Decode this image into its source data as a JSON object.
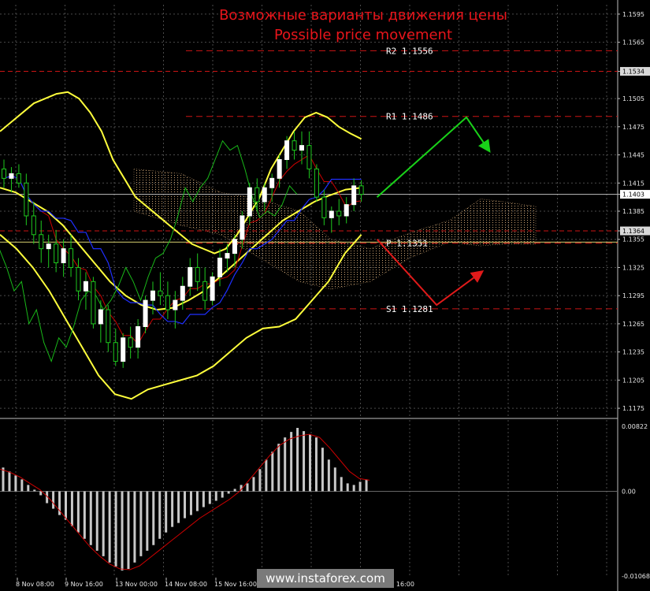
{
  "header": {
    "title_ru": "Возможные варианты движения цены",
    "title_en": "Possible price movement"
  },
  "watermark": "www.instaforex.com",
  "colors": {
    "background": "#000000",
    "bull_candle": "#ffffff",
    "bear_candle": "#9a9a9a",
    "bollinger": "#ffff3c",
    "ichimoku_tenkan": "#cc0000",
    "ichimoku_kijun": "#1f2fff",
    "ichimoku_chikou": "#19b819",
    "cloud": "#c8a070",
    "pivot_lines": "#cc1414",
    "macd_hist": "#c8c8c8",
    "macd_signal": "#cc0000",
    "up_arrow": "#19d119",
    "down_arrow": "#e01a1a"
  },
  "chart_data": {
    "type": "candlestick",
    "symbol_price_axis": {
      "ylim": [
        1.1165,
        1.1605
      ],
      "ticks": [
        "1.1595",
        "1.1565",
        "1.1534",
        "1.1505",
        "1.1475",
        "1.1445",
        "1.1415",
        "1.1403",
        "1.1385",
        "1.1364",
        "1.1355",
        "1.1325",
        "1.1295",
        "1.1265",
        "1.1235",
        "1.1205",
        "1.1175"
      ],
      "highlight_ticks": [
        {
          "label": "1.1534",
          "style": "box-light"
        },
        {
          "label": "1.1403",
          "style": "box-white"
        },
        {
          "label": "1.1364",
          "style": "box-light"
        }
      ]
    },
    "x_tick_labels": [
      "8 Nov 08:00",
      "9 Nov 16:00",
      "13 Nov 00:00",
      "14 Nov 08:00",
      "15 Nov 16:00",
      "16 Nov 16:00"
    ],
    "pivot_levels": [
      {
        "name": "R2",
        "label": "R2  1.1556",
        "value": 1.1556
      },
      {
        "name": "R1",
        "label": "R1  1.1486",
        "value": 1.1486
      },
      {
        "name": "P",
        "label": "P  1.1351",
        "value": 1.1351
      },
      {
        "name": "S1",
        "label": "S1  1.1281",
        "value": 1.1281
      }
    ],
    "horizontal_lines": [
      1.1534,
      1.1403,
      1.1364
    ],
    "candles": [
      [
        1.143,
        1.144,
        1.141,
        1.142
      ],
      [
        1.142,
        1.1432,
        1.1405,
        1.1425
      ],
      [
        1.1425,
        1.1435,
        1.141,
        1.1415
      ],
      [
        1.1415,
        1.1425,
        1.137,
        1.138
      ],
      [
        1.138,
        1.1395,
        1.135,
        1.136
      ],
      [
        1.136,
        1.1375,
        1.133,
        1.1345
      ],
      [
        1.1345,
        1.136,
        1.1325,
        1.135
      ],
      [
        1.135,
        1.1365,
        1.132,
        1.133
      ],
      [
        1.133,
        1.1355,
        1.1315,
        1.1345
      ],
      [
        1.1345,
        1.136,
        1.1315,
        1.1325
      ],
      [
        1.1325,
        1.1335,
        1.129,
        1.13
      ],
      [
        1.13,
        1.132,
        1.128,
        1.131
      ],
      [
        1.131,
        1.1315,
        1.126,
        1.1265
      ],
      [
        1.1265,
        1.129,
        1.1245,
        1.128
      ],
      [
        1.128,
        1.1285,
        1.1235,
        1.1245
      ],
      [
        1.1245,
        1.126,
        1.122,
        1.1225
      ],
      [
        1.1225,
        1.1255,
        1.1218,
        1.125
      ],
      [
        1.125,
        1.1262,
        1.1228,
        1.124
      ],
      [
        1.124,
        1.127,
        1.1228,
        1.1262
      ],
      [
        1.1262,
        1.1295,
        1.1255,
        1.129
      ],
      [
        1.129,
        1.131,
        1.1275,
        1.13
      ],
      [
        1.13,
        1.132,
        1.1285,
        1.1295
      ],
      [
        1.1295,
        1.131,
        1.127,
        1.128
      ],
      [
        1.128,
        1.13,
        1.126,
        1.129
      ],
      [
        1.129,
        1.1315,
        1.128,
        1.1305
      ],
      [
        1.1305,
        1.1335,
        1.1295,
        1.1325
      ],
      [
        1.1325,
        1.134,
        1.13,
        1.131
      ],
      [
        1.131,
        1.1325,
        1.128,
        1.129
      ],
      [
        1.129,
        1.132,
        1.1285,
        1.1315
      ],
      [
        1.1315,
        1.1345,
        1.1305,
        1.1335
      ],
      [
        1.1335,
        1.135,
        1.132,
        1.134
      ],
      [
        1.134,
        1.136,
        1.1325,
        1.1355
      ],
      [
        1.1355,
        1.1385,
        1.1345,
        1.138
      ],
      [
        1.138,
        1.1415,
        1.137,
        1.141
      ],
      [
        1.141,
        1.142,
        1.1385,
        1.1395
      ],
      [
        1.1395,
        1.1415,
        1.1385,
        1.141
      ],
      [
        1.141,
        1.1425,
        1.1395,
        1.142
      ],
      [
        1.142,
        1.1445,
        1.141,
        1.144
      ],
      [
        1.144,
        1.1465,
        1.143,
        1.146
      ],
      [
        1.146,
        1.147,
        1.144,
        1.145
      ],
      [
        1.145,
        1.147,
        1.1435,
        1.1455
      ],
      [
        1.1455,
        1.147,
        1.142,
        1.143
      ],
      [
        1.143,
        1.1435,
        1.1395,
        1.14
      ],
      [
        1.14,
        1.1408,
        1.137,
        1.1378
      ],
      [
        1.1378,
        1.139,
        1.1362,
        1.1385
      ],
      [
        1.1385,
        1.1398,
        1.137,
        1.138
      ],
      [
        1.138,
        1.14,
        1.1372,
        1.1392
      ],
      [
        1.1392,
        1.142,
        1.1385,
        1.1412
      ],
      [
        1.1412,
        1.1418,
        1.1395,
        1.1403
      ]
    ],
    "bollinger_upper": [
      1.147,
      1.148,
      1.149,
      1.15,
      1.1505,
      1.151,
      1.1512,
      1.1505,
      1.149,
      1.147,
      1.144,
      1.142,
      1.14,
      1.139,
      1.138,
      1.137,
      1.136,
      1.135,
      1.1345,
      1.134,
      1.1345,
      1.136,
      1.138,
      1.14,
      1.143,
      1.145,
      1.147,
      1.1485,
      1.149,
      1.1485,
      1.1475,
      1.1468,
      1.1462
    ],
    "bollinger_middle": [
      1.141,
      1.1405,
      1.1395,
      1.1385,
      1.137,
      1.135,
      1.133,
      1.131,
      1.1295,
      1.1285,
      1.128,
      1.1282,
      1.129,
      1.13,
      1.1315,
      1.133,
      1.1345,
      1.136,
      1.1375,
      1.1385,
      1.1395,
      1.1402,
      1.1408,
      1.141
    ],
    "bollinger_lower": [
      1.136,
      1.1345,
      1.1325,
      1.13,
      1.127,
      1.124,
      1.121,
      1.119,
      1.1185,
      1.1195,
      1.12,
      1.1205,
      1.121,
      1.122,
      1.1235,
      1.125,
      1.126,
      1.1262,
      1.127,
      1.129,
      1.131,
      1.134,
      1.136
    ],
    "macd": {
      "ylim": [
        -0.0109,
        0.009
      ],
      "ticks": [
        "0.00822",
        "0.00",
        "-0.01068"
      ],
      "histogram": [
        0.003,
        0.0025,
        0.002,
        0.0015,
        0.0008,
        0.0002,
        -0.0005,
        -0.0015,
        -0.0022,
        -0.003,
        -0.0036,
        -0.0044,
        -0.0052,
        -0.006,
        -0.0068,
        -0.0075,
        -0.0082,
        -0.009,
        -0.0095,
        -0.01,
        -0.0098,
        -0.009,
        -0.0082,
        -0.0075,
        -0.0068,
        -0.006,
        -0.0052,
        -0.0045,
        -0.004,
        -0.0034,
        -0.003,
        -0.0025,
        -0.002,
        -0.0016,
        -0.0012,
        -0.0008,
        -0.0003,
        0.0003,
        0.0008,
        0.001,
        0.0018,
        0.0028,
        0.004,
        0.005,
        0.006,
        0.0068,
        0.0075,
        0.008,
        0.0076,
        0.0072,
        0.0068,
        0.0055,
        0.004,
        0.003,
        0.0018,
        0.001,
        0.0008,
        0.0012,
        0.0015
      ],
      "signal": [
        0.0028,
        0.0024,
        0.0018,
        0.001,
        0.0002,
        -0.001,
        -0.0025,
        -0.004,
        -0.0055,
        -0.007,
        -0.0082,
        -0.0092,
        -0.0098,
        -0.0099,
        -0.0094,
        -0.0084,
        -0.0074,
        -0.0064,
        -0.0054,
        -0.0044,
        -0.0034,
        -0.0026,
        -0.0018,
        -0.001,
        0.0,
        0.0015,
        0.003,
        0.0045,
        0.0058,
        0.0066,
        0.007,
        0.0072,
        0.0068,
        0.0055,
        0.004,
        0.0025,
        0.0016,
        0.0014
      ]
    },
    "forecast_arrows": [
      {
        "color": "up",
        "points": [
          [
            48,
            1.14
          ],
          [
            60,
            1.1485
          ],
          [
            63,
            1.145
          ]
        ]
      },
      {
        "color": "down",
        "points": [
          [
            48,
            1.1355
          ],
          [
            56,
            1.1285
          ],
          [
            62,
            1.132
          ]
        ]
      }
    ]
  }
}
